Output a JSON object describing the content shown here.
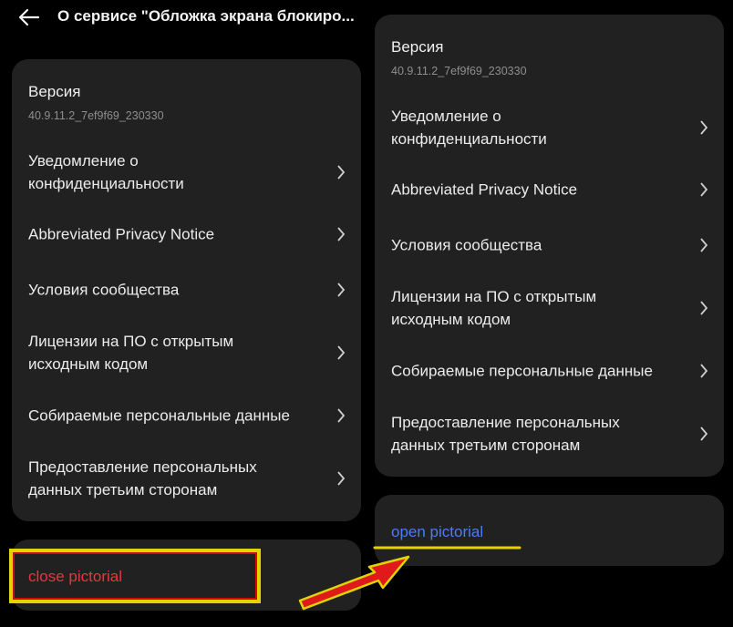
{
  "header": {
    "title": "О сервисе \"Обложка экрана блокиро...",
    "back_icon": "arrow-left-icon"
  },
  "about_list": {
    "version_label": "Версия",
    "version_value": "40.9.11.2_7ef9f69_230330",
    "items": [
      {
        "label": "Уведомление о\nконфиденциальности"
      },
      {
        "label": "Abbreviated Privacy Notice"
      },
      {
        "label": "Условия сообщества"
      },
      {
        "label": "Лицензии на ПО с открытым\nисходным кодом"
      },
      {
        "label": "Собираемые персональные данные"
      },
      {
        "label": "Предоставление персональных\nданных третьим сторонам"
      }
    ],
    "chevron_icon": "chevron-right-icon"
  },
  "actions": {
    "close_label": "close pictorial",
    "open_label": "open pictorial"
  },
  "colors": {
    "background": "#000000",
    "card": "#212121",
    "close_text": "#e8363d",
    "open_text": "#4a7cf2",
    "highlight_box": "#e2d400",
    "highlight_box_inner": "#d10b0b",
    "arrow_fill": "#e01a1a",
    "arrow_outline": "#e2d400",
    "underline": "#e2d400"
  }
}
